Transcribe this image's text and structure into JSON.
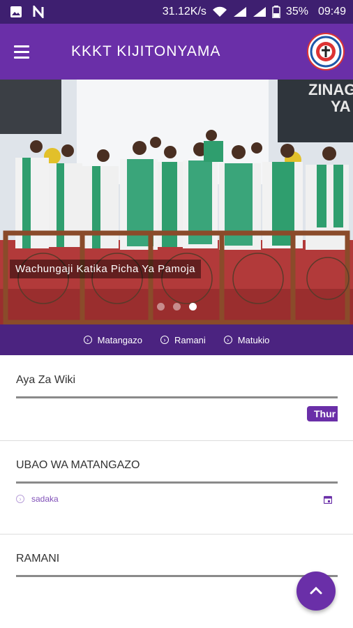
{
  "status_bar": {
    "speed": "31.12K/s",
    "battery": "35%",
    "time": "09:49",
    "icons": [
      "image-icon",
      "n-icon",
      "wifi-icon",
      "signal-icon",
      "signal-icon",
      "battery-icon"
    ]
  },
  "app_bar": {
    "title": "KKKT KIJITONYAMA",
    "menu_icon": "hamburger-menu-icon",
    "logo": "church-seal-logo"
  },
  "hero": {
    "caption": "Wachungaji Katika Picha Ya Pamoja",
    "backdrop_text_1": "ZINAG",
    "backdrop_text_2": "YA",
    "active_slide": 3,
    "slide_count": 3
  },
  "tabs": [
    {
      "label": "Matangazo",
      "icon": "chevron-circle-icon"
    },
    {
      "label": "Ramani",
      "icon": "chevron-circle-icon"
    },
    {
      "label": "Matukio",
      "icon": "chevron-circle-icon"
    }
  ],
  "sections": {
    "aya": {
      "title": "Aya Za Wiki",
      "pill": "Thur"
    },
    "ubao": {
      "title": "UBAO WA MATANGAZO",
      "item": "sadaka",
      "item_icon": "calendar-icon"
    },
    "ramani": {
      "title": "RAMANI"
    }
  },
  "fab": {
    "icon": "chevron-up-icon"
  },
  "colors": {
    "primary": "#6a2fa8",
    "status_bar": "#3e1f70",
    "tab_bar": "#4b2380"
  }
}
